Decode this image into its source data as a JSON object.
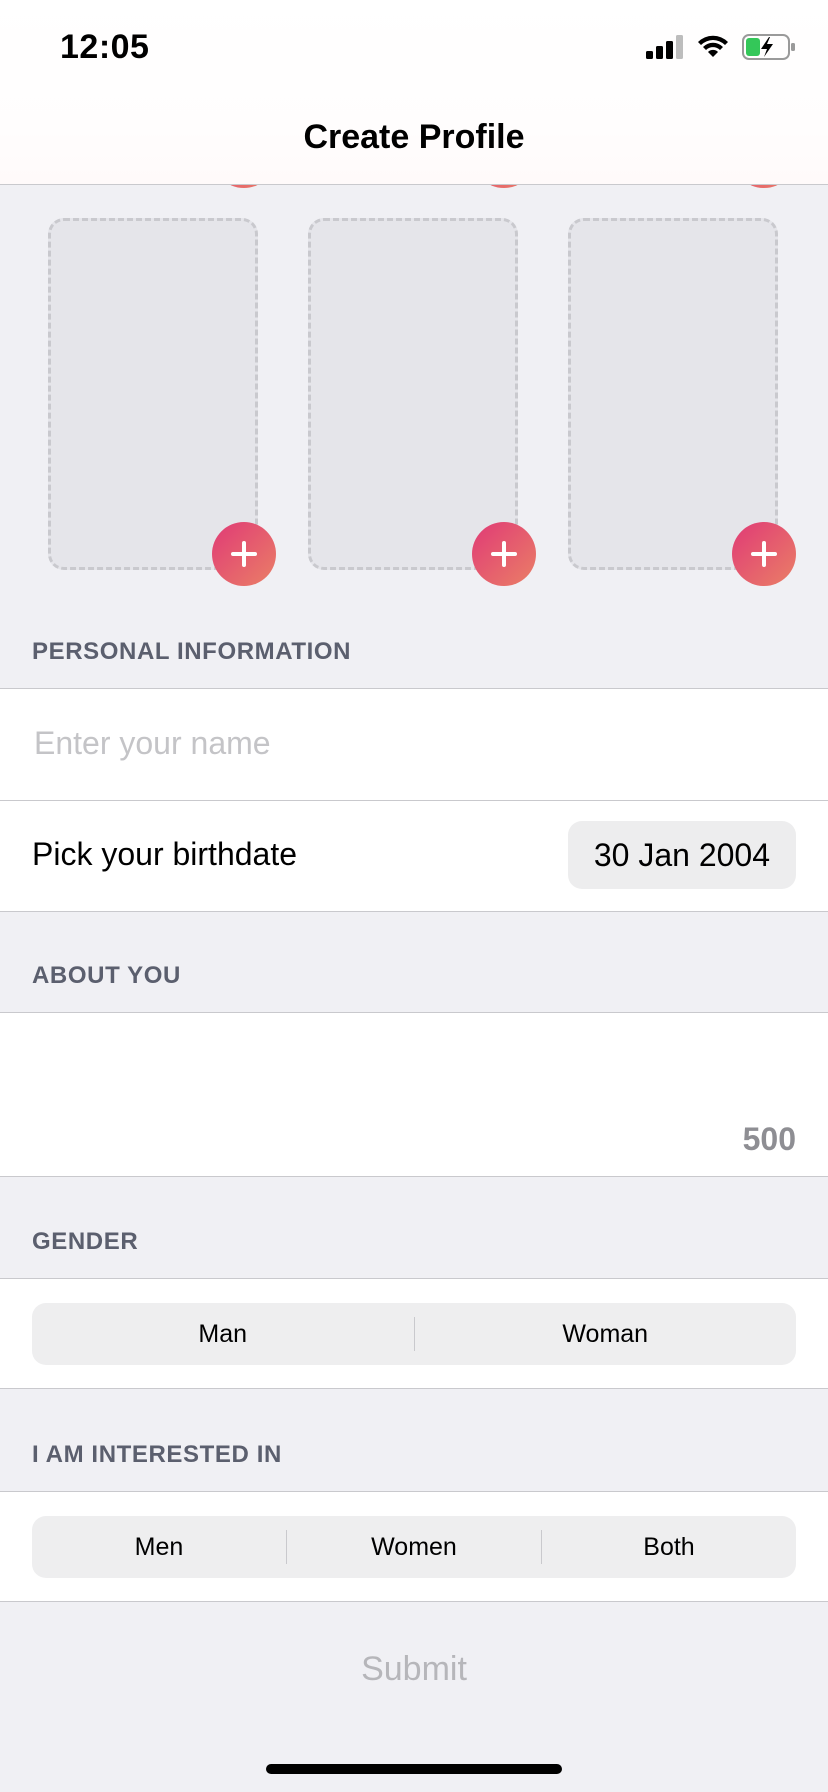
{
  "status_bar": {
    "time": "12:05",
    "icons": [
      "signal-icon",
      "wifi-icon",
      "battery-charging-icon"
    ]
  },
  "nav": {
    "title": "Create Profile"
  },
  "photos": {
    "slot_count": 3,
    "add_icon": "plus-icon"
  },
  "personal": {
    "header": "PERSONAL INFORMATION",
    "name_placeholder": "Enter your name",
    "name_value": "",
    "birthdate_label": "Pick your birthdate",
    "birthdate_value": "30 Jan 2004"
  },
  "about": {
    "header": "ABOUT YOU",
    "text": "",
    "char_remaining": "500"
  },
  "gender": {
    "header": "GENDER",
    "options": [
      "Man",
      "Woman"
    ]
  },
  "interest": {
    "header": "I AM INTERESTED IN",
    "options": [
      "Men",
      "Women",
      "Both"
    ]
  },
  "submit_label": "Submit",
  "colors": {
    "accent_gradient_start": "#e03a76",
    "accent_gradient_end": "#ea7f66",
    "background": "#f0f0f4",
    "section_header": "#5b5f6e",
    "disabled_text": "#b6b6ba"
  }
}
